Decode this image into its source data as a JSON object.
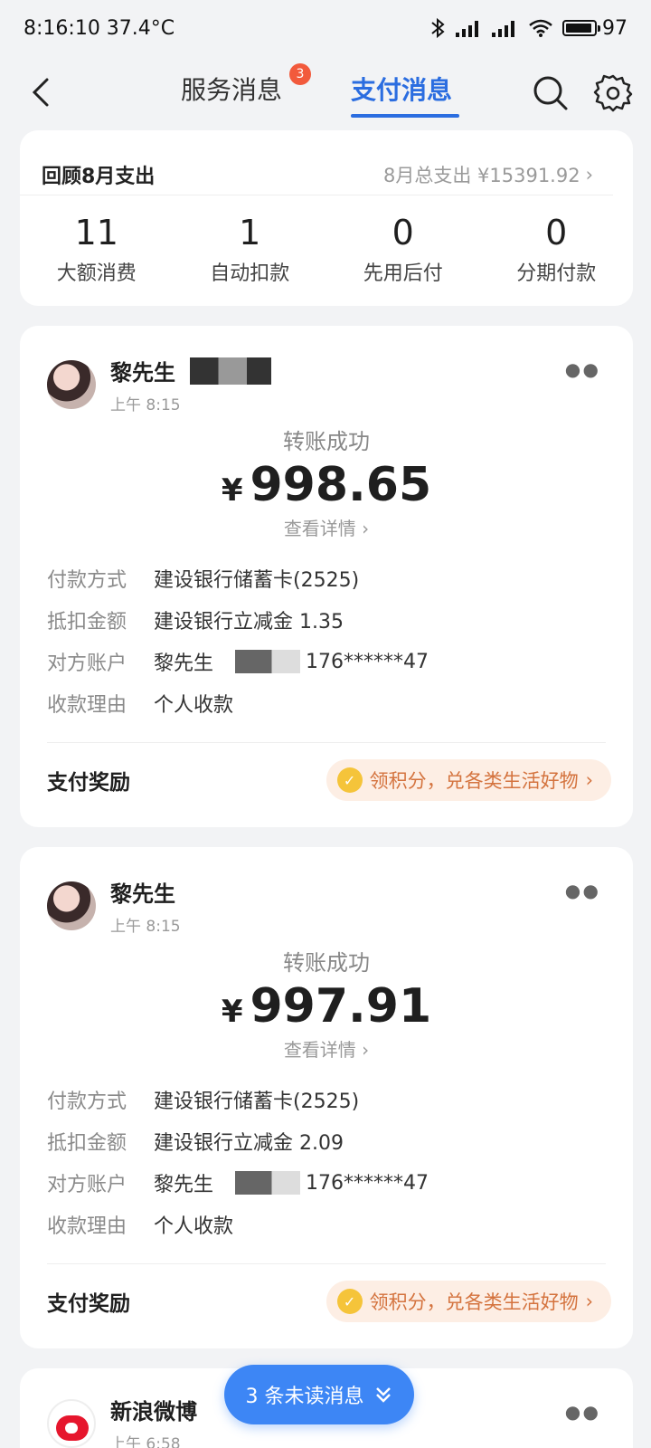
{
  "status_bar": {
    "time_temp": "8:16:10 37.4°C",
    "battery": "97"
  },
  "nav": {
    "tab_service": "服务消息",
    "service_badge": "3",
    "tab_pay": "支付消息"
  },
  "summary": {
    "title": "回顾8月支出",
    "total": "8月总支出 ¥15391.92",
    "stats": [
      {
        "num": "11",
        "label": "大额消费"
      },
      {
        "num": "1",
        "label": "自动扣款"
      },
      {
        "num": "0",
        "label": "先用后付"
      },
      {
        "num": "0",
        "label": "分期付款"
      }
    ]
  },
  "payments": [
    {
      "name": "黎先生",
      "time": "上午 8:15",
      "status": "转账成功",
      "currency": "¥",
      "amount": "998.65",
      "detail_link": "查看详情",
      "rows": [
        {
          "label": "付款方式",
          "value": "建设银行储蓄卡(2525)"
        },
        {
          "label": "抵扣金额",
          "value": "建设银行立减金 1.35"
        },
        {
          "label": "对方账户",
          "value_prefix": "黎先生",
          "value_suffix": "176******47"
        },
        {
          "label": "收款理由",
          "value": "个人收款"
        }
      ],
      "reward_label": "支付奖励",
      "reward_text": "领积分，兑各类生活好物"
    },
    {
      "name": "黎先生",
      "time": "上午 8:15",
      "status": "转账成功",
      "currency": "¥",
      "amount": "997.91",
      "detail_link": "查看详情",
      "rows": [
        {
          "label": "付款方式",
          "value": "建设银行储蓄卡(2525)"
        },
        {
          "label": "抵扣金额",
          "value": "建设银行立减金 2.09"
        },
        {
          "label": "对方账户",
          "value_prefix": "黎先生",
          "value_suffix": "176******47"
        },
        {
          "label": "收款理由",
          "value": "个人收款"
        }
      ],
      "reward_label": "支付奖励",
      "reward_text": "领积分，兑各类生活好物"
    }
  ],
  "weibo": {
    "name": "新浪微博",
    "time": "上午 6:58"
  },
  "unread": {
    "label": "3 条未读消息"
  },
  "colors": {
    "accent": "#2b6de0",
    "badge": "#f25a3c",
    "reward": "#d4733e"
  }
}
